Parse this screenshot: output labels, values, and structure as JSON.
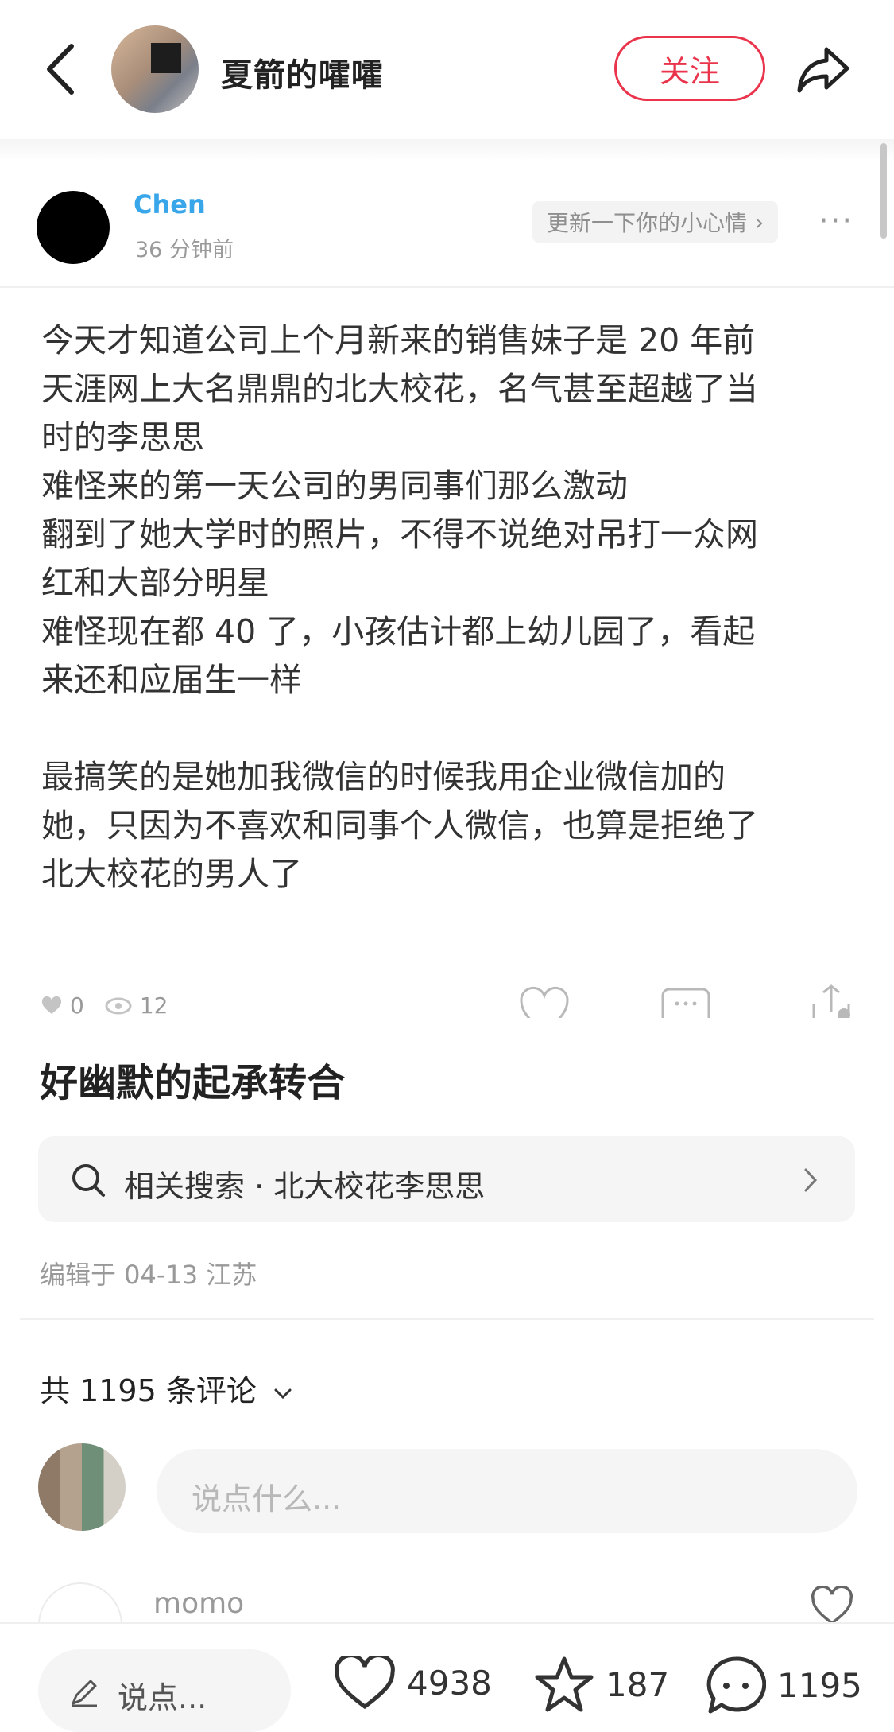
{
  "header": {
    "author_name": "夏箭的嚯嚯",
    "follow_label": "关注"
  },
  "post": {
    "user_name": "Chen",
    "time": "36 分钟前",
    "mood_label": "更新一下你的小心情",
    "body": "今天才知道公司上个月新来的销售妹子是 20 年前\n天涯网上大名鼎鼎的北大校花，名气甚至超越了当\n时的李思思\n难怪来的第一天公司的男同事们那么激动\n翻到了她大学时的照片，不得不说绝对吊打一众网\n红和大部分明星\n难怪现在都 40 了，小孩估计都上幼儿园了，看起\n来还和应届生一样\n\n最搞笑的是她加我微信的时候我用企业微信加的\n她，只因为不喜欢和同事个人微信，也算是拒绝了\n北大校花的男人了",
    "likes": "0",
    "views": "12"
  },
  "note": {
    "title": "好幽默的起承转合",
    "related_search": "相关搜索 · 北大校花李思思",
    "edit_info": "编辑于 04-13 江苏",
    "comment_count": "共 1195 条评论"
  },
  "comment_input": {
    "placeholder": "说点什么..."
  },
  "first_comment": {
    "user": "momo"
  },
  "bottom_bar": {
    "say_label": "说点...",
    "likes": "4938",
    "favorites": "187",
    "comments": "1195"
  },
  "colors": {
    "accent": "#e9344b",
    "link_blue": "#39a6ea"
  }
}
